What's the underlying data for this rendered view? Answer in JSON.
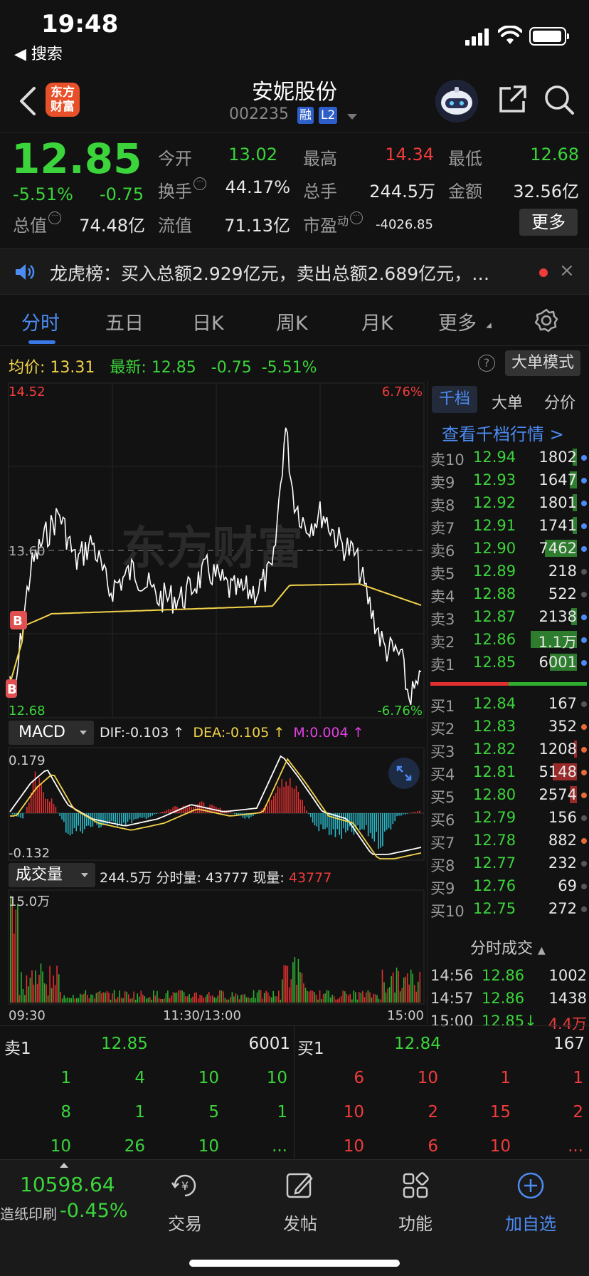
{
  "status": {
    "time": "19:48",
    "back_label": "◀ 搜索"
  },
  "header": {
    "logo": "东方\n财富",
    "name": "安妮股份",
    "code": "002235",
    "tag1": "融",
    "tag2": "L2"
  },
  "quote": {
    "price": "12.85",
    "change_pct": "-5.51%",
    "change_amt": "-0.75",
    "open_label": "今开",
    "open": "13.02",
    "high_label": "最高",
    "high": "14.34",
    "low_label": "最低",
    "low": "12.68",
    "turnover_label": "换手",
    "turnover": "44.17%",
    "volume_label": "总手",
    "volume": "244.5万",
    "amount_label": "金额",
    "amount": "32.56亿",
    "mktcap_label": "总值",
    "mktcap": "74.48亿",
    "float_label": "流值",
    "float": "71.13亿",
    "pe_label": "市盈",
    "pe_sup": "动",
    "pe": "-4026.85",
    "more_label": "更多"
  },
  "notice": {
    "text": "龙虎榜：买入总额2.929亿元，卖出总额2.689亿元，…",
    "close": "×"
  },
  "tabs": {
    "fenshi": "分时",
    "wuri": "五日",
    "rik": "日K",
    "zhouk": "周K",
    "yuek": "月K",
    "more": "更多"
  },
  "avgline": {
    "avg_label": "均价:",
    "avg": "13.31",
    "latest_label": "最新:",
    "latest": "12.85",
    "chg": "-0.75",
    "pct": "-5.51%",
    "help": "?",
    "mode_btn": "大单模式"
  },
  "chart": {
    "y_top": "14.52",
    "y_mid": "13.60",
    "y_bot": "12.68",
    "pct_top": "6.76%",
    "pct_bot": "-6.76%",
    "watermark": "东方财富",
    "b_marker": "B",
    "macd_label": "MACD",
    "dif": "DIF:-0.103 ↑",
    "dea": "DEA:-0.105 ↑",
    "m": "M:0.004 ↑",
    "macd_top": "0.179",
    "macd_bot": "-0.132",
    "vol_label": "成交量",
    "vol_total": "244.5万",
    "vol_min_label": "分时量:",
    "vol_min": "43777",
    "vol_now_label": "现量:",
    "vol_now": "43777",
    "vol_top": "15.0万",
    "x_start": "09:30",
    "x_mid": "11:30/13:00",
    "x_end": "15:00"
  },
  "orderbook": {
    "tabs": [
      "千档",
      "大单",
      "分价"
    ],
    "link": "查看千档行情 >",
    "asks": [
      {
        "label": "卖10",
        "price": "12.94",
        "vol": "1802",
        "bar": 0.06,
        "dot": "#4d8cf5"
      },
      {
        "label": "卖9",
        "price": "12.93",
        "vol": "1647",
        "bar": 0.1,
        "dot": "#4d8cf5"
      },
      {
        "label": "卖8",
        "price": "12.92",
        "vol": "1801",
        "bar": 0.06,
        "dot": "#4d8cf5"
      },
      {
        "label": "卖7",
        "price": "12.91",
        "vol": "1741",
        "bar": 0.06,
        "dot": "#4d8cf5"
      },
      {
        "label": "卖6",
        "price": "12.90",
        "vol": "7462",
        "bar": 0.45,
        "dot": "#4d8cf5"
      },
      {
        "label": "卖5",
        "price": "12.89",
        "vol": "218",
        "bar": 0,
        "dot": "#555"
      },
      {
        "label": "卖4",
        "price": "12.88",
        "vol": "522",
        "bar": 0,
        "dot": "#555"
      },
      {
        "label": "卖3",
        "price": "12.87",
        "vol": "2138",
        "bar": 0.08,
        "dot": "#4d8cf5"
      },
      {
        "label": "卖2",
        "price": "12.86",
        "vol": "1.1万",
        "bar": 0.65,
        "dot": "#4d8cf5"
      },
      {
        "label": "卖1",
        "price": "12.85",
        "vol": "6001",
        "bar": 0.38,
        "dot": "#4d8cf5"
      }
    ],
    "bids": [
      {
        "label": "买1",
        "price": "12.84",
        "vol": "167",
        "bar": 0,
        "dot": "#555"
      },
      {
        "label": "买2",
        "price": "12.83",
        "vol": "352",
        "bar": 0,
        "dot": "#e86a3a"
      },
      {
        "label": "买3",
        "price": "12.82",
        "vol": "1208",
        "bar": 0.04,
        "dot": "#e86a3a"
      },
      {
        "label": "买4",
        "price": "12.81",
        "vol": "5148",
        "bar": 0.34,
        "dot": "#e86a3a"
      },
      {
        "label": "买5",
        "price": "12.80",
        "vol": "2574",
        "bar": 0.1,
        "dot": "#e86a3a"
      },
      {
        "label": "买6",
        "price": "12.79",
        "vol": "156",
        "bar": 0,
        "dot": "#555"
      },
      {
        "label": "买7",
        "price": "12.78",
        "vol": "882",
        "bar": 0,
        "dot": "#e86a3a"
      },
      {
        "label": "买8",
        "price": "12.77",
        "vol": "232",
        "bar": 0,
        "dot": "#555"
      },
      {
        "label": "买9",
        "price": "12.76",
        "vol": "69",
        "bar": 0,
        "dot": "#555"
      },
      {
        "label": "买10",
        "price": "12.75",
        "vol": "272",
        "bar": 0,
        "dot": "#555"
      }
    ],
    "trades_title": "分时成交",
    "trades": [
      {
        "time": "14:56",
        "price": "12.86",
        "vol": "1002",
        "vol_color": "#e8e8e8"
      },
      {
        "time": "14:57",
        "price": "12.86",
        "vol": "1438",
        "vol_color": "#e8e8e8"
      },
      {
        "time": "15:00",
        "price": "12.85↓",
        "vol": "4.4万",
        "vol_color": "#f03c3c"
      }
    ]
  },
  "level1": {
    "sell_label": "卖1",
    "sell_price": "12.85",
    "sell_vol": "6001",
    "buy_label": "买1",
    "buy_price": "12.84",
    "buy_vol": "167",
    "sell_rows": [
      [
        "1",
        "4",
        "10",
        "10"
      ],
      [
        "8",
        "1",
        "5",
        "1"
      ],
      [
        "10",
        "26",
        "10",
        "..."
      ]
    ],
    "buy_rows": [
      [
        "6",
        "10",
        "1",
        "1"
      ],
      [
        "10",
        "2",
        "15",
        "2"
      ],
      [
        "10",
        "6",
        "10",
        "..."
      ]
    ]
  },
  "bottomnav": {
    "index_value": "10598.64",
    "index_name": "造纸印刷",
    "index_pct": "-0.45%",
    "trade": "交易",
    "post": "发帖",
    "func": "功能",
    "watch": "加自选"
  },
  "colors": {
    "up": "#f03c3c",
    "down": "#3bd43b",
    "accent": "#4d8cf5",
    "avg": "#f2d34a"
  }
}
